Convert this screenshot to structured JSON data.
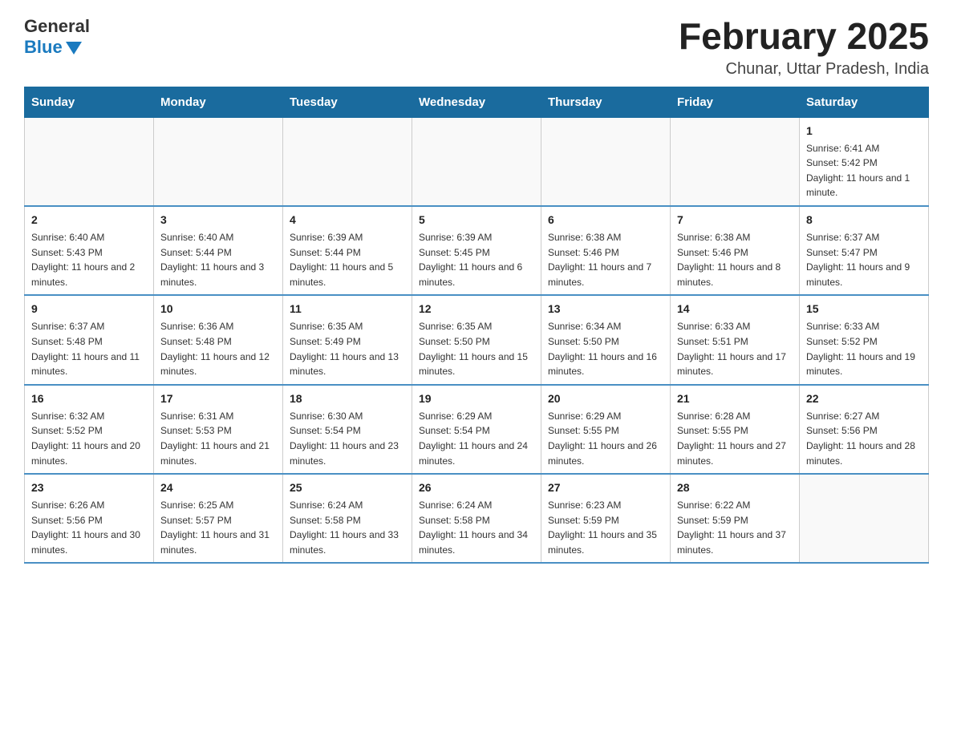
{
  "header": {
    "logo_general": "General",
    "logo_blue": "Blue",
    "month_title": "February 2025",
    "location": "Chunar, Uttar Pradesh, India"
  },
  "weekdays": [
    "Sunday",
    "Monday",
    "Tuesday",
    "Wednesday",
    "Thursday",
    "Friday",
    "Saturday"
  ],
  "weeks": [
    [
      {
        "day": "",
        "info": ""
      },
      {
        "day": "",
        "info": ""
      },
      {
        "day": "",
        "info": ""
      },
      {
        "day": "",
        "info": ""
      },
      {
        "day": "",
        "info": ""
      },
      {
        "day": "",
        "info": ""
      },
      {
        "day": "1",
        "info": "Sunrise: 6:41 AM\nSunset: 5:42 PM\nDaylight: 11 hours and 1 minute."
      }
    ],
    [
      {
        "day": "2",
        "info": "Sunrise: 6:40 AM\nSunset: 5:43 PM\nDaylight: 11 hours and 2 minutes."
      },
      {
        "day": "3",
        "info": "Sunrise: 6:40 AM\nSunset: 5:44 PM\nDaylight: 11 hours and 3 minutes."
      },
      {
        "day": "4",
        "info": "Sunrise: 6:39 AM\nSunset: 5:44 PM\nDaylight: 11 hours and 5 minutes."
      },
      {
        "day": "5",
        "info": "Sunrise: 6:39 AM\nSunset: 5:45 PM\nDaylight: 11 hours and 6 minutes."
      },
      {
        "day": "6",
        "info": "Sunrise: 6:38 AM\nSunset: 5:46 PM\nDaylight: 11 hours and 7 minutes."
      },
      {
        "day": "7",
        "info": "Sunrise: 6:38 AM\nSunset: 5:46 PM\nDaylight: 11 hours and 8 minutes."
      },
      {
        "day": "8",
        "info": "Sunrise: 6:37 AM\nSunset: 5:47 PM\nDaylight: 11 hours and 9 minutes."
      }
    ],
    [
      {
        "day": "9",
        "info": "Sunrise: 6:37 AM\nSunset: 5:48 PM\nDaylight: 11 hours and 11 minutes."
      },
      {
        "day": "10",
        "info": "Sunrise: 6:36 AM\nSunset: 5:48 PM\nDaylight: 11 hours and 12 minutes."
      },
      {
        "day": "11",
        "info": "Sunrise: 6:35 AM\nSunset: 5:49 PM\nDaylight: 11 hours and 13 minutes."
      },
      {
        "day": "12",
        "info": "Sunrise: 6:35 AM\nSunset: 5:50 PM\nDaylight: 11 hours and 15 minutes."
      },
      {
        "day": "13",
        "info": "Sunrise: 6:34 AM\nSunset: 5:50 PM\nDaylight: 11 hours and 16 minutes."
      },
      {
        "day": "14",
        "info": "Sunrise: 6:33 AM\nSunset: 5:51 PM\nDaylight: 11 hours and 17 minutes."
      },
      {
        "day": "15",
        "info": "Sunrise: 6:33 AM\nSunset: 5:52 PM\nDaylight: 11 hours and 19 minutes."
      }
    ],
    [
      {
        "day": "16",
        "info": "Sunrise: 6:32 AM\nSunset: 5:52 PM\nDaylight: 11 hours and 20 minutes."
      },
      {
        "day": "17",
        "info": "Sunrise: 6:31 AM\nSunset: 5:53 PM\nDaylight: 11 hours and 21 minutes."
      },
      {
        "day": "18",
        "info": "Sunrise: 6:30 AM\nSunset: 5:54 PM\nDaylight: 11 hours and 23 minutes."
      },
      {
        "day": "19",
        "info": "Sunrise: 6:29 AM\nSunset: 5:54 PM\nDaylight: 11 hours and 24 minutes."
      },
      {
        "day": "20",
        "info": "Sunrise: 6:29 AM\nSunset: 5:55 PM\nDaylight: 11 hours and 26 minutes."
      },
      {
        "day": "21",
        "info": "Sunrise: 6:28 AM\nSunset: 5:55 PM\nDaylight: 11 hours and 27 minutes."
      },
      {
        "day": "22",
        "info": "Sunrise: 6:27 AM\nSunset: 5:56 PM\nDaylight: 11 hours and 28 minutes."
      }
    ],
    [
      {
        "day": "23",
        "info": "Sunrise: 6:26 AM\nSunset: 5:56 PM\nDaylight: 11 hours and 30 minutes."
      },
      {
        "day": "24",
        "info": "Sunrise: 6:25 AM\nSunset: 5:57 PM\nDaylight: 11 hours and 31 minutes."
      },
      {
        "day": "25",
        "info": "Sunrise: 6:24 AM\nSunset: 5:58 PM\nDaylight: 11 hours and 33 minutes."
      },
      {
        "day": "26",
        "info": "Sunrise: 6:24 AM\nSunset: 5:58 PM\nDaylight: 11 hours and 34 minutes."
      },
      {
        "day": "27",
        "info": "Sunrise: 6:23 AM\nSunset: 5:59 PM\nDaylight: 11 hours and 35 minutes."
      },
      {
        "day": "28",
        "info": "Sunrise: 6:22 AM\nSunset: 5:59 PM\nDaylight: 11 hours and 37 minutes."
      },
      {
        "day": "",
        "info": ""
      }
    ]
  ]
}
